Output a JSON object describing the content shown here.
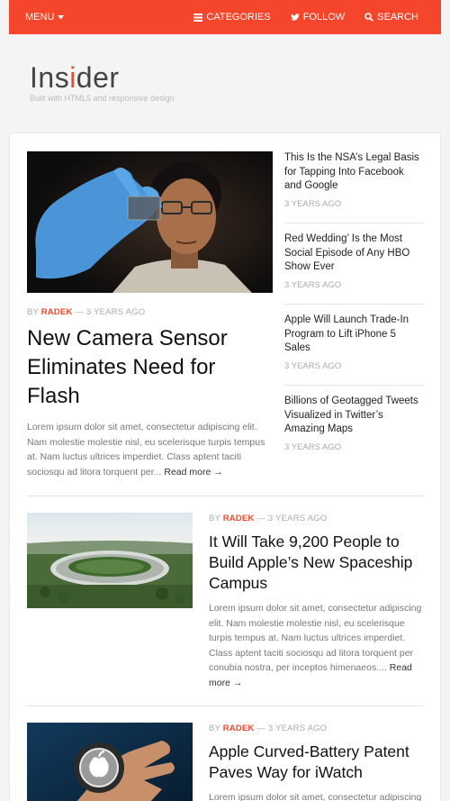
{
  "nav": {
    "menu_label": "MENU",
    "categories_label": "CATEGORIES",
    "follow_label": "FOLLOW",
    "search_label": "SEARCH",
    "accent_color": "#f5452a"
  },
  "brand": {
    "logo_part1": "Ins",
    "logo_accent": "i",
    "logo_part2": "der",
    "tagline": "Built with HTML5 and responsive design"
  },
  "hero": {
    "by": "BY",
    "author": "RADEK",
    "date": "— 3 YEARS AGO",
    "title": "New Camera Sensor Eliminates Need for Flash",
    "excerpt": "Lorem ipsum dolor sit amet, consectetur adipiscing elit. Nam molestie molestie nisl, eu scelerisque turpis tempus at. Nam luctus ultrices imperdiet. Class aptent taciti sociosqu ad litora torquent per...",
    "read_more": "Read more →"
  },
  "sidebar": [
    {
      "title": "This Is the NSA’s Legal Basis for Tapping Into Facebook and Google",
      "date": "3 YEARS AGO"
    },
    {
      "title": "Red Wedding’ Is the Most Social Episode of Any HBO Show Ever",
      "date": "3 YEARS AGO"
    },
    {
      "title": "Apple Will Launch Trade-In Program to Lift iPhone 5 Sales",
      "date": "3 YEARS AGO"
    },
    {
      "title": "Billions of Geotagged Tweets Visualized in Twitter’s Amazing Maps",
      "date": "3 YEARS AGO"
    }
  ],
  "articles": [
    {
      "by": "BY",
      "author": "RADEK",
      "date": "— 3 YEARS AGO",
      "title": "It Will Take 9,200 People to Build Apple’s New Spaceship Campus",
      "excerpt": "Lorem ipsum dolor sit amet, consectetur adipiscing elit. Nam molestie molestie nisl, eu scelerisque turpis tempus at. Nam luctus ultrices imperdiet. Class aptent taciti sociosqu ad litora torquent per conubia nostra, per inceptos himenaeos....",
      "read_more": "Read more →"
    },
    {
      "by": "BY",
      "author": "RADEK",
      "date": "— 3 YEARS AGO",
      "title": "Apple Curved-Battery Patent Paves Way for iWatch",
      "excerpt": "Lorem ipsum dolor sit amet, consectetur adipiscing elit."
    }
  ]
}
